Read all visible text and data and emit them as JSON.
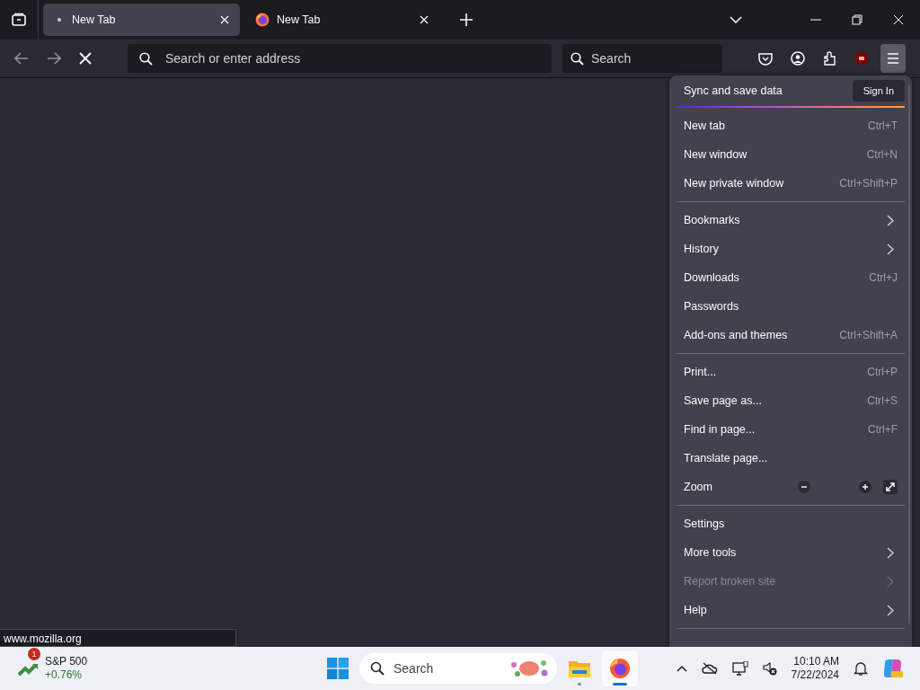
{
  "tabs": [
    {
      "title": "New Tab",
      "selected": true,
      "kind": "loading"
    },
    {
      "title": "New Tab",
      "selected": false,
      "kind": "favicon"
    }
  ],
  "toolbar": {
    "address_placeholder": "Search or enter address",
    "search_placeholder": "Search",
    "loading": true
  },
  "menu": {
    "header": {
      "title": "Sync and save data",
      "button": "Sign In"
    },
    "items": [
      {
        "kind": "item",
        "label": "New tab",
        "shortcut": "Ctrl+T"
      },
      {
        "kind": "item",
        "label": "New window",
        "shortcut": "Ctrl+N"
      },
      {
        "kind": "item",
        "label": "New private window",
        "shortcut": "Ctrl+Shift+P"
      },
      {
        "kind": "separator"
      },
      {
        "kind": "submenu",
        "label": "Bookmarks",
        "disabled": false
      },
      {
        "kind": "submenu",
        "label": "History",
        "disabled": false
      },
      {
        "kind": "item",
        "label": "Downloads",
        "shortcut": "Ctrl+J"
      },
      {
        "kind": "item",
        "label": "Passwords"
      },
      {
        "kind": "item",
        "label": "Add-ons and themes",
        "shortcut": "Ctrl+Shift+A"
      },
      {
        "kind": "separator"
      },
      {
        "kind": "item",
        "label": "Print...",
        "shortcut": "Ctrl+P"
      },
      {
        "kind": "item",
        "label": "Save page as...",
        "shortcut": "Ctrl+S"
      },
      {
        "kind": "item",
        "label": "Find in page...",
        "shortcut": "Ctrl+F"
      },
      {
        "kind": "item",
        "label": "Translate page..."
      },
      {
        "kind": "zoom",
        "label": "Zoom"
      },
      {
        "kind": "separator"
      },
      {
        "kind": "item",
        "label": "Settings"
      },
      {
        "kind": "submenu",
        "label": "More tools",
        "disabled": false
      },
      {
        "kind": "submenu",
        "label": "Report broken site",
        "disabled": true
      },
      {
        "kind": "submenu",
        "label": "Help",
        "disabled": false
      },
      {
        "kind": "separator"
      }
    ]
  },
  "status_link": "www.mozilla.org",
  "taskbar": {
    "widget": {
      "name": "S&P 500",
      "change": "+0.76%",
      "badge": "1"
    },
    "search_placeholder": "Search",
    "apps": [
      {
        "kind": "files",
        "selected": false
      },
      {
        "kind": "firefox",
        "selected": true
      }
    ],
    "time": "10:10 AM",
    "date": "7/22/2024"
  }
}
